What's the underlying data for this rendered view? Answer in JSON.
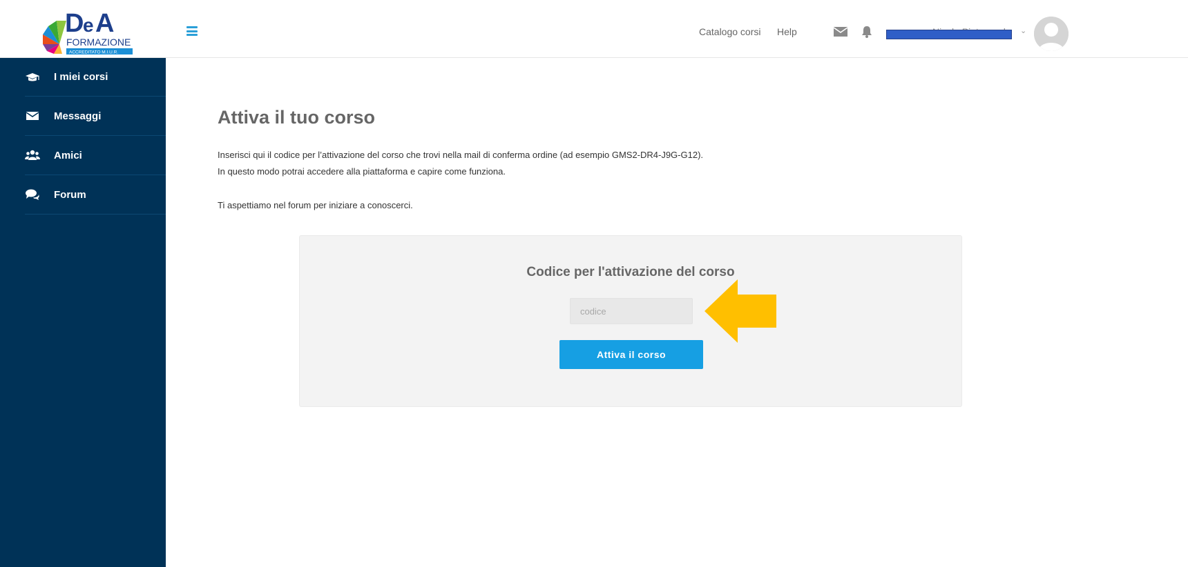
{
  "header": {
    "logo_text": "DeA FORMAZIONE",
    "logo_sub": "ACCREDITATO M.I.U.R.",
    "links": {
      "catalog": "Catalogo corsi",
      "help": "Help"
    },
    "user_name": "Nicola Pietrangelo",
    "user_chevron": "⌄",
    "icons": [
      "menu-icon",
      "mail-icon",
      "bell-icon",
      "avatar"
    ]
  },
  "sidebar": {
    "items": [
      {
        "label": "I miei corsi",
        "icon": "graduation-cap-icon"
      },
      {
        "label": "Messaggi",
        "icon": "envelope-icon"
      },
      {
        "label": "Amici",
        "icon": "users-icon"
      },
      {
        "label": "Forum",
        "icon": "comments-icon"
      }
    ]
  },
  "main": {
    "title": "Attiva il tuo corso",
    "intro_line1": "Inserisci qui il codice per l’attivazione del corso che trovi nella mail di conferma ordine (ad esempio GMS2-DR4-J9G-G12).",
    "intro_line2": "In questo modo potrai accedere alla piattaforma e capire come funziona.",
    "intro_line3": "Ti aspettiamo nel forum per iniziare a conoscerci.",
    "card": {
      "title": "Codice per l'attivazione del corso",
      "input_placeholder": "codice",
      "input_value": "",
      "button_label": "Attiva il corso"
    }
  },
  "colors": {
    "sidebar_bg": "#003257",
    "accent": "#169fe3",
    "arrow": "#ffbf00",
    "redaction": "#2f5ec7"
  }
}
